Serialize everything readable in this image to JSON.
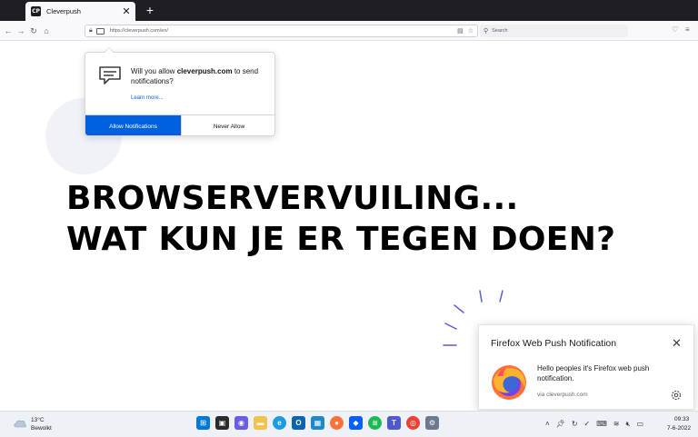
{
  "browser": {
    "tab": {
      "favicon": "CP",
      "title": "Cleverpush",
      "close_icon": "close-icon"
    },
    "new_tab_icon": "plus-icon",
    "url": "https://cleverpush.com/en/",
    "search_placeholder": "Search"
  },
  "permission_prompt": {
    "question_prefix": "Will you allow ",
    "domain": "cleverpush.com",
    "question_suffix": " to send notifications?",
    "learn_more": "Learn more...",
    "allow_label": "Allow Notifications",
    "deny_label": "Never Allow"
  },
  "headline": {
    "line1": "BROWSERVERVUILING...",
    "line2": "WAT KUN JE ER TEGEN DOEN?"
  },
  "notification": {
    "title": "Firefox Web Push Notification",
    "body": "Hello peoples it's Firefox web push notification.",
    "via": "via cleverpush.com"
  },
  "taskbar": {
    "weather_temp": "13°C",
    "weather_desc": "Bewolkt",
    "time": "09:33",
    "date": "7-6-2022"
  },
  "colors": {
    "accent": "#0061e0",
    "tab_strip": "#1f1e25",
    "ray_color": "#5b5bd6"
  }
}
